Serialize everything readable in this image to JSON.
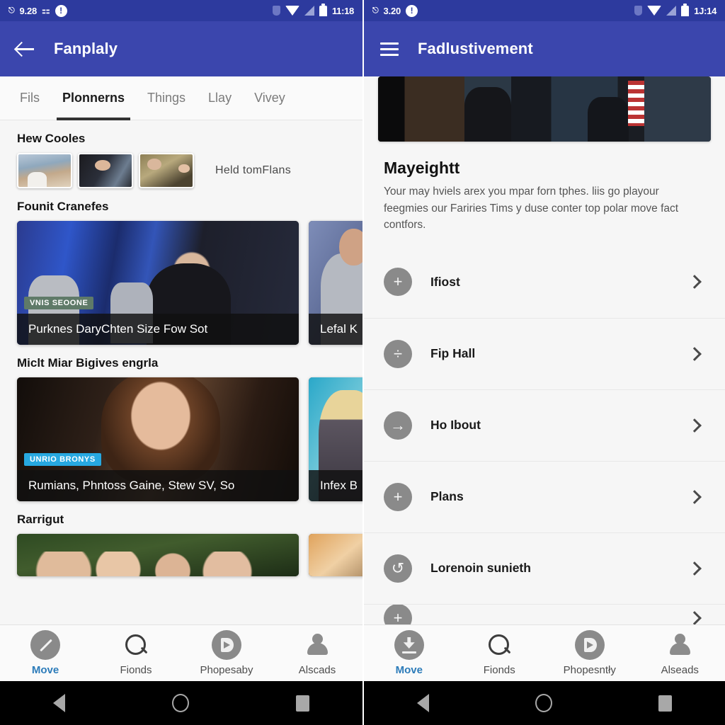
{
  "left": {
    "status_bar": {
      "carrier_text": "9.28",
      "sim_icon": "sim-card-icon",
      "alert_icon": "exclamation-circle-icon",
      "shield_icon": "shield-icon",
      "wifi_icon": "wifi-icon",
      "signal_icon": "cellular-signal-icon",
      "battery_icon": "battery-icon",
      "clock": "11:18"
    },
    "appbar": {
      "back_icon": "arrow-back-icon",
      "title": "Fanplaly"
    },
    "tabs": [
      {
        "label": "Fils",
        "active": false
      },
      {
        "label": "Plonnerns",
        "active": true
      },
      {
        "label": "Things",
        "active": false
      },
      {
        "label": "Llay",
        "active": false
      },
      {
        "label": "Vivey",
        "active": false
      }
    ],
    "sections": [
      {
        "title": "Hew Cooles",
        "type": "thumbs",
        "caption": "Held tomFlans",
        "thumbs": [
          "thumbnail-crowd",
          "thumbnail-portrait",
          "thumbnail-couple"
        ]
      },
      {
        "title": "Founit Cranefes",
        "type": "cards",
        "cards": [
          {
            "badge": "VNIS SEOONE",
            "badge_color": "#5f7a68",
            "caption": "Purknes DaryChten Size Fow Sot"
          },
          {
            "badge": "",
            "badge_color": "",
            "caption": "Lefal K"
          }
        ]
      },
      {
        "title": "Miclt Miar Bigives engrla",
        "type": "cards",
        "cards": [
          {
            "badge": "UNRIO BRONYS",
            "badge_color": "#27a8e0",
            "caption": "Rumians, Phntoss Gaine, Stew SV, So"
          },
          {
            "badge": "",
            "badge_color": "",
            "caption": "Infex B"
          }
        ]
      },
      {
        "title": "Rarrigut",
        "type": "cards_cut",
        "cards": [
          {
            "badge": "",
            "caption": ""
          },
          {
            "badge": "",
            "caption": ""
          }
        ]
      }
    ],
    "bottom_nav": [
      {
        "label": "Move",
        "icon": "edit-pencil-circle-icon",
        "active": true
      },
      {
        "label": "Fionds",
        "icon": "search-icon",
        "active": false
      },
      {
        "label": "Phopesaby",
        "icon": "play-circle-icon",
        "active": false
      },
      {
        "label": "Alscads",
        "icon": "person-icon",
        "active": false
      }
    ],
    "system_nav": {
      "back": "system-back-icon",
      "home": "system-home-icon",
      "recents": "system-recents-icon"
    }
  },
  "right": {
    "status_bar": {
      "carrier_text": "3.20",
      "sim_icon": "sim-card-icon",
      "alert_icon": "exclamation-circle-icon",
      "shield_icon": "shield-icon",
      "wifi_icon": "wifi-icon",
      "signal_icon": "cellular-signal-icon",
      "battery_icon": "battery-icon",
      "clock": "1J:14"
    },
    "appbar": {
      "menu_icon": "hamburger-menu-icon",
      "title": "Fadlustivement"
    },
    "hero_image": "interview-studio-photo",
    "heading": "Mayeightt",
    "body": "Your may hviels arex you mpar forn tphes. liis go playour feegmies our Fariries Tims y duse conter top polar move fact contfors.",
    "list": [
      {
        "label": "Ifiost",
        "icon": "plus-circle-icon",
        "symbol": "+",
        "chevron": "chevron-right-icon"
      },
      {
        "label": "Fip Hall",
        "icon": "minus-circle-icon",
        "symbol": "÷",
        "chevron": "chevron-right-icon"
      },
      {
        "label": "Ho Ibout",
        "icon": "arrow-right-circle-icon",
        "symbol": "→",
        "chevron": "chevron-right-icon"
      },
      {
        "label": "Plans",
        "icon": "plus-circle-icon",
        "symbol": "+",
        "chevron": "chevron-right-icon"
      },
      {
        "label": "Lorenoin sunieth",
        "icon": "history-circle-icon",
        "symbol": "↺",
        "chevron": "chevron-right-icon"
      },
      {
        "label": "",
        "icon": "plus-circle-icon",
        "symbol": "+",
        "chevron": "chevron-right-icon"
      }
    ],
    "bottom_nav": [
      {
        "label": "Move",
        "icon": "download-circle-icon",
        "active": true
      },
      {
        "label": "Fionds",
        "icon": "search-icon",
        "active": false
      },
      {
        "label": "Phopesntły",
        "icon": "play-circle-icon",
        "active": false
      },
      {
        "label": "Alseads",
        "icon": "person-icon",
        "active": false
      }
    ],
    "system_nav": {
      "back": "system-back-icon",
      "home": "system-home-icon",
      "recents": "system-recents-icon"
    }
  },
  "colors": {
    "statusbar": "#2d3a9e",
    "appbar": "#3b46ad",
    "accent": "#2b7bb9",
    "badge_blue": "#27a8e0"
  }
}
